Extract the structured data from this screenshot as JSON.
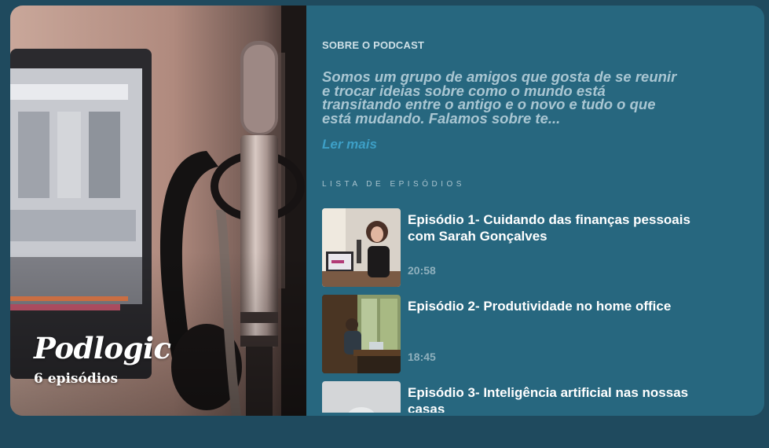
{
  "podcast": {
    "title": "Podlogic",
    "episode_count": "6 episódios"
  },
  "about": {
    "label": "SOBRE O PODCAST",
    "text": "Somos um grupo de amigos que gosta de se reunir e trocar ideias sobre como o mundo está transitando entre o antigo e o novo e tudo o que está mudando. Falamos sobre te...",
    "read_more": "Ler mais"
  },
  "episodes": {
    "label": "LISTA DE EPISÓDIOS",
    "items": [
      {
        "title": "Episódio 1- Cuidando das finanças pessoais com Sarah Gonçalves",
        "duration": "20:58"
      },
      {
        "title": "Episódio 2- Produtividade no home office",
        "duration": "18:45"
      },
      {
        "title": "Episódio 3- Inteligência artificial nas nossas casas",
        "duration": ""
      }
    ]
  },
  "colors": {
    "page_bg": "#1f4a5e",
    "card_bg": "#27677f",
    "accent_link": "#3d9fc6"
  }
}
